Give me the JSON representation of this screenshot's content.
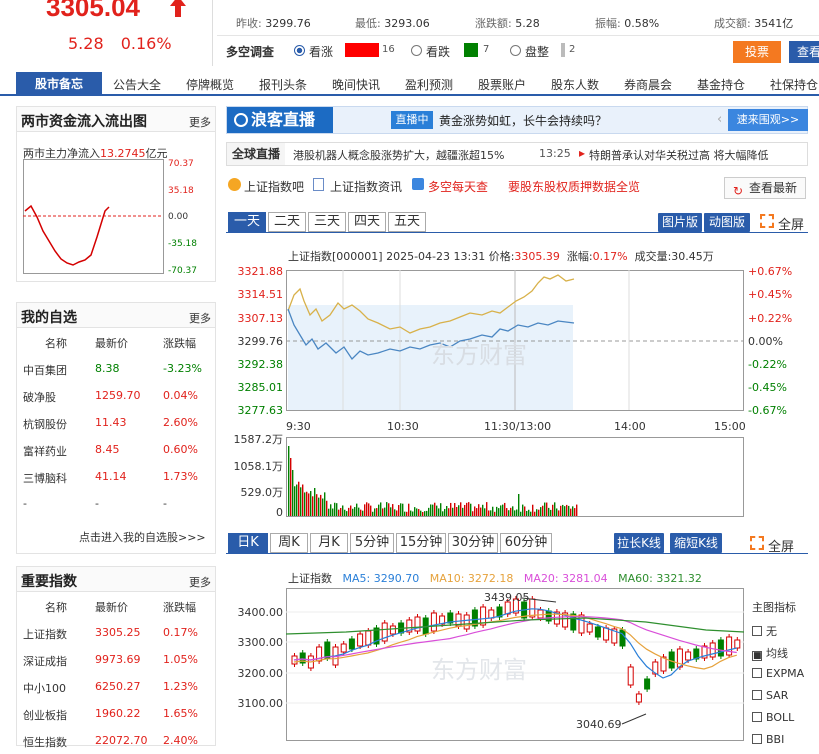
{
  "quote": {
    "price": "3305.04",
    "change": "5.28",
    "change_pct": "0.16%",
    "up_color": "#e1221c",
    "down_color": "#008000"
  },
  "stats": [
    {
      "label": "昨收:",
      "value": "3299.76"
    },
    {
      "label": "最低:",
      "value": "3293.06"
    },
    {
      "label": "涨跌额:",
      "value": "5.28"
    },
    {
      "label": "振幅:",
      "value": "0.58%"
    },
    {
      "label": "成交额:",
      "value": "3541亿"
    }
  ],
  "poll": {
    "title": "多空调查",
    "bull": "看涨",
    "bull_count": "16",
    "bear": "看跌",
    "bear_count": "7",
    "flat": "盘整",
    "flat_count": "2",
    "vote_btn": "投票",
    "view_btn": "查看"
  },
  "nav": {
    "first": "股市备忘",
    "items": [
      "公告大全",
      "停牌概览",
      "报刊头条",
      "晚间快讯",
      "盈利预测",
      "股票账户",
      "股东人数",
      "券商晨会",
      "基金持仓",
      "社保持仓"
    ]
  },
  "flow": {
    "title": "两市资金流入流出图",
    "more": "更多",
    "label": "两市主力净流入",
    "value": "13.2745",
    "unit": "亿元",
    "ticks": [
      "70.37",
      "35.18",
      "0.00",
      "-35.18",
      "-70.37"
    ]
  },
  "watch": {
    "title": "我的自选",
    "more": "更多",
    "headers": [
      "名称",
      "最新价",
      "涨跌幅"
    ],
    "rows": [
      {
        "name": "中百集团",
        "price": "8.38",
        "pct": "-3.23%",
        "up": false
      },
      {
        "name": "破净股",
        "price": "1259.70",
        "pct": "0.04%",
        "up": true
      },
      {
        "name": "杭钢股份",
        "price": "11.43",
        "pct": "2.60%",
        "up": true
      },
      {
        "name": "富祥药业",
        "price": "8.45",
        "pct": "0.60%",
        "up": true
      },
      {
        "name": "三博脑科",
        "price": "41.14",
        "pct": "1.73%",
        "up": true
      },
      {
        "name": "-",
        "price": "-",
        "pct": "-",
        "up": null
      }
    ],
    "link": "点击进入我的自选股>>>"
  },
  "index": {
    "title": "重要指数",
    "more": "更多",
    "headers": [
      "名称",
      "最新价",
      "涨跌幅"
    ],
    "rows": [
      {
        "name": "上证指数",
        "price": "3305.25",
        "pct": "0.17%"
      },
      {
        "name": "深证成指",
        "price": "9973.69",
        "pct": "1.05%"
      },
      {
        "name": "中小100",
        "price": "6250.27",
        "pct": "1.23%"
      },
      {
        "name": "创业板指",
        "price": "1960.22",
        "pct": "1.65%"
      },
      {
        "name": "恒生指数",
        "price": "22072.70",
        "pct": "2.40%"
      }
    ]
  },
  "live": {
    "logo": "浪客直播",
    "badge": "直播中",
    "headline": "黄金涨势如虹，长牛会持续吗？",
    "watch_btn": "速来围观>>"
  },
  "ticker": {
    "label": "全球直播",
    "item1": "港股机器人概念股涨势扩大，越疆涨超15%",
    "time1": "13:25",
    "item2": "特朗普承认对华关税过高 将大幅降低"
  },
  "links": {
    "a": "上证指数吧",
    "b": "上证指数资讯",
    "c": "多空每天查",
    "d": "要股东股权质押数据全览",
    "refresh": "查看最新"
  },
  "intraday_tabs": [
    "一天",
    "二天",
    "三天",
    "四天",
    "五天"
  ],
  "view_modes": {
    "pic": "图片版",
    "dyn": "动图版",
    "full": "全屏"
  },
  "intraday": {
    "info": "上证指数[000001]  2025-04-23 13:31  价格:",
    "price": "3305.39",
    "pct_label": "涨幅:",
    "pct": "0.17%",
    "vol_label": "成交量:",
    "vol": "30.45万",
    "y_left": [
      "3321.88",
      "3314.51",
      "3307.13",
      "3299.76",
      "3292.38",
      "3285.01",
      "3277.63"
    ],
    "y_right": [
      "+0.67%",
      "+0.45%",
      "+0.22%",
      "0.00%",
      "-0.22%",
      "-0.45%",
      "-0.67%"
    ],
    "x_labels": [
      "9:30",
      "10:30",
      "11:30/13:00",
      "14:00",
      "15:00"
    ],
    "vol_ticks": [
      "1587.2万",
      "1058.1万",
      "529.0万",
      "0"
    ],
    "watermark": "东方财富"
  },
  "kline_tabs": [
    "日K",
    "周K",
    "月K",
    "5分钟",
    "15分钟",
    "30分钟",
    "60分钟"
  ],
  "kline_btns": {
    "long": "拉长K线",
    "short": "缩短K线",
    "full": "全屏"
  },
  "kline": {
    "name": "上证指数",
    "ma5": "MA5: 3290.70",
    "ma10": "MA10: 3272.18",
    "ma20": "MA20: 3281.04",
    "ma60": "MA60: 3321.32",
    "y_ticks": [
      "3400.00",
      "3300.00",
      "3200.00",
      "3100.00"
    ],
    "high_label": "3439.05",
    "low_label": "3040.69",
    "watermark": "东方财富",
    "colors": {
      "ma5": "#2a7fd8",
      "ma10": "#e6a23c",
      "ma20": "#d94fd9",
      "ma60": "#2f8f2f"
    }
  },
  "indicators": {
    "title": "主图指标",
    "items": [
      {
        "label": "无",
        "checked": false
      },
      {
        "label": "均线",
        "checked": true
      },
      {
        "label": "EXPMA",
        "checked": false
      },
      {
        "label": "SAR",
        "checked": false
      },
      {
        "label": "BOLL",
        "checked": false
      },
      {
        "label": "BBI",
        "checked": false
      }
    ]
  }
}
